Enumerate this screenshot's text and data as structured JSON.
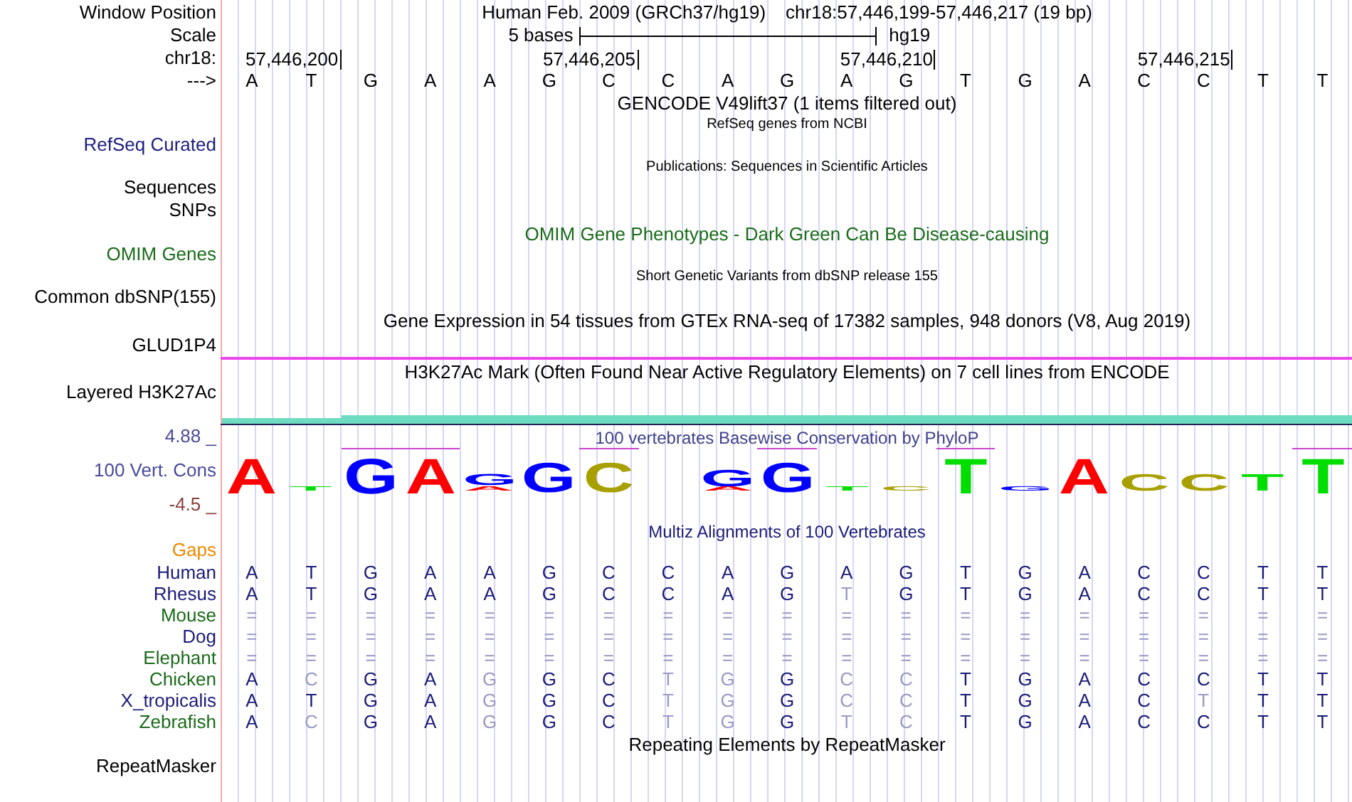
{
  "header": {
    "label": "Window Position",
    "assembly": "Human Feb. 2009 (GRCh37/hg19)",
    "position": "chr18:57,446,199-57,446,217 (19 bp)"
  },
  "scale": {
    "label": "Scale",
    "length": "5 bases",
    "assembly": "hg19"
  },
  "ruler": {
    "label": "chr18:",
    "ticks": [
      "57,446,200",
      "57,446,205",
      "57,446,210",
      "57,446,215"
    ]
  },
  "sequence": {
    "label": "--->",
    "bases": [
      "A",
      "T",
      "G",
      "A",
      "A",
      "G",
      "C",
      "C",
      "A",
      "G",
      "A",
      "G",
      "T",
      "G",
      "A",
      "C",
      "C",
      "T",
      "T"
    ]
  },
  "tracks": [
    {
      "kind": "title",
      "title": "GENCODE V49lift37 (1 items filtered out)"
    },
    {
      "kind": "track",
      "title": "RefSeq genes from NCBI",
      "small": true,
      "label": "RefSeq Curated",
      "color": "#1c1c80"
    },
    {
      "kind": "track",
      "title": "Publications: Sequences in Scientific Articles",
      "small": true,
      "label": "Sequences",
      "color": "#000000"
    },
    {
      "kind": "label",
      "label": "SNPs",
      "color": "#000000"
    },
    {
      "kind": "track",
      "title": "OMIM Gene Phenotypes - Dark Green Can Be Disease-causing",
      "small": false,
      "label": "OMIM Genes",
      "color": "#1a6b1a"
    },
    {
      "kind": "track",
      "title": "Short Genetic Variants from dbSNP release 155",
      "small": true,
      "label": "Common dbSNP(155)",
      "color": "#000000"
    },
    {
      "kind": "expression",
      "title": "Gene Expression in 54 tissues from GTEx RNA-seq of 17382 samples, 948 donors (V8, Aug 2019)",
      "label": "GLUD1P4",
      "color": "#000000"
    },
    {
      "kind": "signal",
      "title": "H3K27Ac Mark (Often Found Near Active Regulatory Elements) on 7 cell lines from ENCODE",
      "label": "Layered H3K27Ac",
      "color": "#000000"
    }
  ],
  "conservation": {
    "max": "4.88 _",
    "label": "100 Vert. Cons",
    "min": "-4.5 _",
    "title": "100 vertebrates Basewise Conservation by PhyloP",
    "columns": [
      {
        "marked": false,
        "letters": [
          {
            "base": "A",
            "color": "#ff0000"
          }
        ]
      },
      {
        "marked": false,
        "letters": [
          {
            "base": "T",
            "color": "#00dd00"
          }
        ]
      },
      {
        "marked": true,
        "letters": [
          {
            "base": "G",
            "color": "#0000ff"
          }
        ]
      },
      {
        "marked": true,
        "letters": [
          {
            "base": "A",
            "color": "#ff0000"
          }
        ]
      },
      {
        "marked": false,
        "letters": [
          {
            "base": "G",
            "color": "#0000ff"
          },
          {
            "base": "A",
            "color": "#ff0000"
          }
        ]
      },
      {
        "marked": false,
        "letters": [
          {
            "base": "G",
            "color": "#0000ff"
          }
        ]
      },
      {
        "marked": true,
        "letters": [
          {
            "base": "C",
            "color": "#a8a000"
          }
        ]
      },
      {
        "marked": false
      },
      {
        "marked": false,
        "letters": [
          {
            "base": "G",
            "color": "#0000ff"
          },
          {
            "base": "A",
            "color": "#ff0000"
          }
        ]
      },
      {
        "marked": true,
        "letters": [
          {
            "base": "G",
            "color": "#0000ff"
          }
        ]
      },
      {
        "marked": false,
        "letters": [
          {
            "base": "T",
            "color": "#00dd00"
          }
        ]
      },
      {
        "marked": false,
        "letters": [
          {
            "base": "C",
            "color": "#a8a000"
          }
        ]
      },
      {
        "marked": true,
        "letters": [
          {
            "base": "T",
            "color": "#00dd00"
          }
        ]
      },
      {
        "marked": false,
        "letters": [
          {
            "base": "G",
            "color": "#0000ff"
          }
        ]
      },
      {
        "marked": false,
        "letters": [
          {
            "base": "A",
            "color": "#ff0000"
          }
        ]
      },
      {
        "marked": false,
        "letters": [
          {
            "base": "C",
            "color": "#a8a000"
          }
        ]
      },
      {
        "marked": false,
        "letters": [
          {
            "base": "C",
            "color": "#a8a000"
          }
        ]
      },
      {
        "marked": false,
        "letters": [
          {
            "base": "T",
            "color": "#00dd00"
          }
        ]
      },
      {
        "marked": true,
        "letters": [
          {
            "base": "T",
            "color": "#00dd00"
          }
        ]
      }
    ]
  },
  "alignment": {
    "title": "Multiz Alignments of 100 Vertebrates",
    "gaps_label": "Gaps",
    "species": [
      {
        "name": "Human",
        "color": "#1a1a78",
        "bases": [
          {
            "base": "A",
            "faded": false
          },
          {
            "base": "T",
            "faded": false
          },
          {
            "base": "G",
            "faded": false
          },
          {
            "base": "A",
            "faded": false
          },
          {
            "base": "A",
            "faded": false
          },
          {
            "base": "G",
            "faded": false
          },
          {
            "base": "C",
            "faded": false
          },
          {
            "base": "C",
            "faded": false
          },
          {
            "base": "A",
            "faded": false
          },
          {
            "base": "G",
            "faded": false
          },
          {
            "base": "A",
            "faded": false
          },
          {
            "base": "G",
            "faded": false
          },
          {
            "base": "T",
            "faded": false
          },
          {
            "base": "G",
            "faded": false
          },
          {
            "base": "A",
            "faded": false
          },
          {
            "base": "C",
            "faded": false
          },
          {
            "base": "C",
            "faded": false
          },
          {
            "base": "T",
            "faded": false
          },
          {
            "base": "T",
            "faded": false
          }
        ]
      },
      {
        "name": "Rhesus",
        "color": "#1a1a78",
        "bases": [
          {
            "base": "A",
            "faded": false
          },
          {
            "base": "T",
            "faded": false
          },
          {
            "base": "G",
            "faded": false
          },
          {
            "base": "A",
            "faded": false
          },
          {
            "base": "A",
            "faded": false
          },
          {
            "base": "G",
            "faded": false
          },
          {
            "base": "C",
            "faded": false
          },
          {
            "base": "C",
            "faded": false
          },
          {
            "base": "A",
            "faded": false
          },
          {
            "base": "G",
            "faded": false
          },
          {
            "base": "T",
            "faded": true
          },
          {
            "base": "G",
            "faded": false
          },
          {
            "base": "T",
            "faded": false
          },
          {
            "base": "G",
            "faded": false
          },
          {
            "base": "A",
            "faded": false
          },
          {
            "base": "C",
            "faded": false
          },
          {
            "base": "C",
            "faded": false
          },
          {
            "base": "T",
            "faded": false
          },
          {
            "base": "T",
            "faded": false
          }
        ]
      },
      {
        "name": "Mouse",
        "color": "#1a6b1a",
        "bases": [
          {
            "base": "=",
            "faded": true
          },
          {
            "base": "=",
            "faded": true
          },
          {
            "base": "=",
            "faded": true
          },
          {
            "base": "=",
            "faded": true
          },
          {
            "base": "=",
            "faded": true
          },
          {
            "base": "=",
            "faded": true
          },
          {
            "base": "=",
            "faded": true
          },
          {
            "base": "=",
            "faded": true
          },
          {
            "base": "=",
            "faded": true
          },
          {
            "base": "=",
            "faded": true
          },
          {
            "base": "=",
            "faded": true
          },
          {
            "base": "=",
            "faded": true
          },
          {
            "base": "=",
            "faded": true
          },
          {
            "base": "=",
            "faded": true
          },
          {
            "base": "=",
            "faded": true
          },
          {
            "base": "=",
            "faded": true
          },
          {
            "base": "=",
            "faded": true
          },
          {
            "base": "=",
            "faded": true
          },
          {
            "base": "=",
            "faded": true
          }
        ]
      },
      {
        "name": "Dog",
        "color": "#1a1a78",
        "bases": [
          {
            "base": "=",
            "faded": true
          },
          {
            "base": "=",
            "faded": true
          },
          {
            "base": "=",
            "faded": true
          },
          {
            "base": "=",
            "faded": true
          },
          {
            "base": "=",
            "faded": true
          },
          {
            "base": "=",
            "faded": true
          },
          {
            "base": "=",
            "faded": true
          },
          {
            "base": "=",
            "faded": true
          },
          {
            "base": "=",
            "faded": true
          },
          {
            "base": "=",
            "faded": true
          },
          {
            "base": "=",
            "faded": true
          },
          {
            "base": "=",
            "faded": true
          },
          {
            "base": "=",
            "faded": true
          },
          {
            "base": "=",
            "faded": true
          },
          {
            "base": "=",
            "faded": true
          },
          {
            "base": "=",
            "faded": true
          },
          {
            "base": "=",
            "faded": true
          },
          {
            "base": "=",
            "faded": true
          },
          {
            "base": "=",
            "faded": true
          }
        ]
      },
      {
        "name": "Elephant",
        "color": "#1a6b1a",
        "bases": [
          {
            "base": "=",
            "faded": true
          },
          {
            "base": "=",
            "faded": true
          },
          {
            "base": "=",
            "faded": true
          },
          {
            "base": "=",
            "faded": true
          },
          {
            "base": "=",
            "faded": true
          },
          {
            "base": "=",
            "faded": true
          },
          {
            "base": "=",
            "faded": true
          },
          {
            "base": "=",
            "faded": true
          },
          {
            "base": "=",
            "faded": true
          },
          {
            "base": "=",
            "faded": true
          },
          {
            "base": "=",
            "faded": true
          },
          {
            "base": "=",
            "faded": true
          },
          {
            "base": "=",
            "faded": true
          },
          {
            "base": "=",
            "faded": true
          },
          {
            "base": "=",
            "faded": true
          },
          {
            "base": "=",
            "faded": true
          },
          {
            "base": "=",
            "faded": true
          },
          {
            "base": "=",
            "faded": true
          },
          {
            "base": "=",
            "faded": true
          }
        ]
      },
      {
        "name": "Chicken",
        "color": "#1a6b1a",
        "bases": [
          {
            "base": "A",
            "faded": false
          },
          {
            "base": "C",
            "faded": true
          },
          {
            "base": "G",
            "faded": false
          },
          {
            "base": "A",
            "faded": false
          },
          {
            "base": "G",
            "faded": true
          },
          {
            "base": "G",
            "faded": false
          },
          {
            "base": "C",
            "faded": false
          },
          {
            "base": "T",
            "faded": true
          },
          {
            "base": "G",
            "faded": true
          },
          {
            "base": "G",
            "faded": false
          },
          {
            "base": "C",
            "faded": true
          },
          {
            "base": "C",
            "faded": true
          },
          {
            "base": "T",
            "faded": false
          },
          {
            "base": "G",
            "faded": false
          },
          {
            "base": "A",
            "faded": false
          },
          {
            "base": "C",
            "faded": false
          },
          {
            "base": "C",
            "faded": false
          },
          {
            "base": "T",
            "faded": false
          },
          {
            "base": "T",
            "faded": false
          }
        ]
      },
      {
        "name": "X_tropicalis",
        "color": "#1a1a78",
        "bases": [
          {
            "base": "A",
            "faded": false
          },
          {
            "base": "T",
            "faded": false
          },
          {
            "base": "G",
            "faded": false
          },
          {
            "base": "A",
            "faded": false
          },
          {
            "base": "G",
            "faded": true
          },
          {
            "base": "G",
            "faded": false
          },
          {
            "base": "C",
            "faded": false
          },
          {
            "base": "T",
            "faded": true
          },
          {
            "base": "G",
            "faded": true
          },
          {
            "base": "G",
            "faded": false
          },
          {
            "base": "C",
            "faded": true
          },
          {
            "base": "C",
            "faded": true
          },
          {
            "base": "T",
            "faded": false
          },
          {
            "base": "G",
            "faded": false
          },
          {
            "base": "A",
            "faded": false
          },
          {
            "base": "C",
            "faded": false
          },
          {
            "base": "T",
            "faded": true
          },
          {
            "base": "T",
            "faded": false
          },
          {
            "base": "T",
            "faded": false
          }
        ]
      },
      {
        "name": "Zebrafish",
        "color": "#1a6b1a",
        "bases": [
          {
            "base": "A",
            "faded": false
          },
          {
            "base": "C",
            "faded": true
          },
          {
            "base": "G",
            "faded": false
          },
          {
            "base": "A",
            "faded": false
          },
          {
            "base": "G",
            "faded": true
          },
          {
            "base": "G",
            "faded": false
          },
          {
            "base": "C",
            "faded": false
          },
          {
            "base": "T",
            "faded": true
          },
          {
            "base": "G",
            "faded": true
          },
          {
            "base": "G",
            "faded": false
          },
          {
            "base": "T",
            "faded": true
          },
          {
            "base": "C",
            "faded": true
          },
          {
            "base": "T",
            "faded": false
          },
          {
            "base": "G",
            "faded": false
          },
          {
            "base": "A",
            "faded": false
          },
          {
            "base": "C",
            "faded": false
          },
          {
            "base": "C",
            "faded": false
          },
          {
            "base": "T",
            "faded": false
          },
          {
            "base": "T",
            "faded": false
          }
        ]
      }
    ]
  },
  "repeats": {
    "title": "Repeating Elements by RepeatMasker",
    "label": "RepeatMasker"
  }
}
